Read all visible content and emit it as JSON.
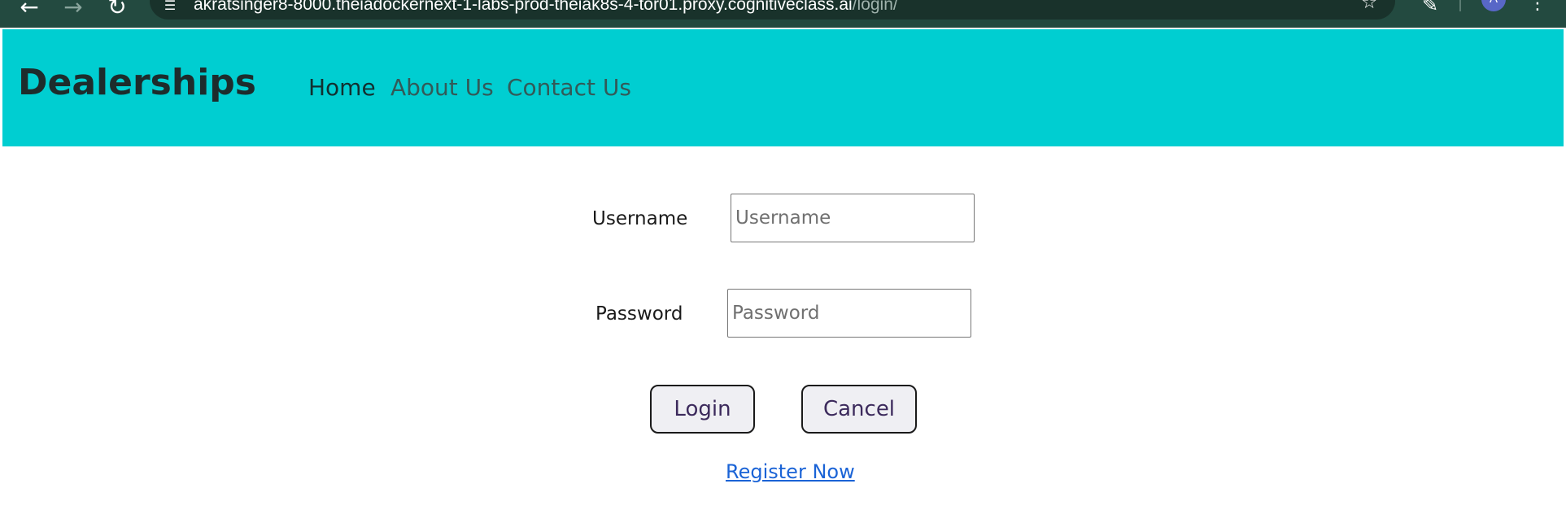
{
  "browser": {
    "url_host": "akratsinger8-8000.theiadockernext-1-labs-prod-theiak8s-4-tor01.proxy.cognitiveclass.ai",
    "url_path": "/login/",
    "profile_initial": "A",
    "icons": {
      "back": "arrow-left-icon",
      "forward": "arrow-right-icon",
      "reload": "reload-icon",
      "site_info": "tune-icon",
      "bookmark": "star-icon",
      "extensions": "extensions-icon",
      "menu": "kebab-menu-icon"
    }
  },
  "navbar": {
    "brand": "Dealerships",
    "links": [
      {
        "label": "Home",
        "active": true
      },
      {
        "label": "About Us",
        "active": false
      },
      {
        "label": "Contact Us",
        "active": false
      }
    ],
    "background": "#00ced1"
  },
  "login_form": {
    "username": {
      "label": "Username",
      "placeholder": "Username",
      "value": ""
    },
    "password": {
      "label": "Password",
      "placeholder": "Password",
      "value": ""
    },
    "login_button": "Login",
    "cancel_button": "Cancel",
    "register_link": "Register Now"
  }
}
